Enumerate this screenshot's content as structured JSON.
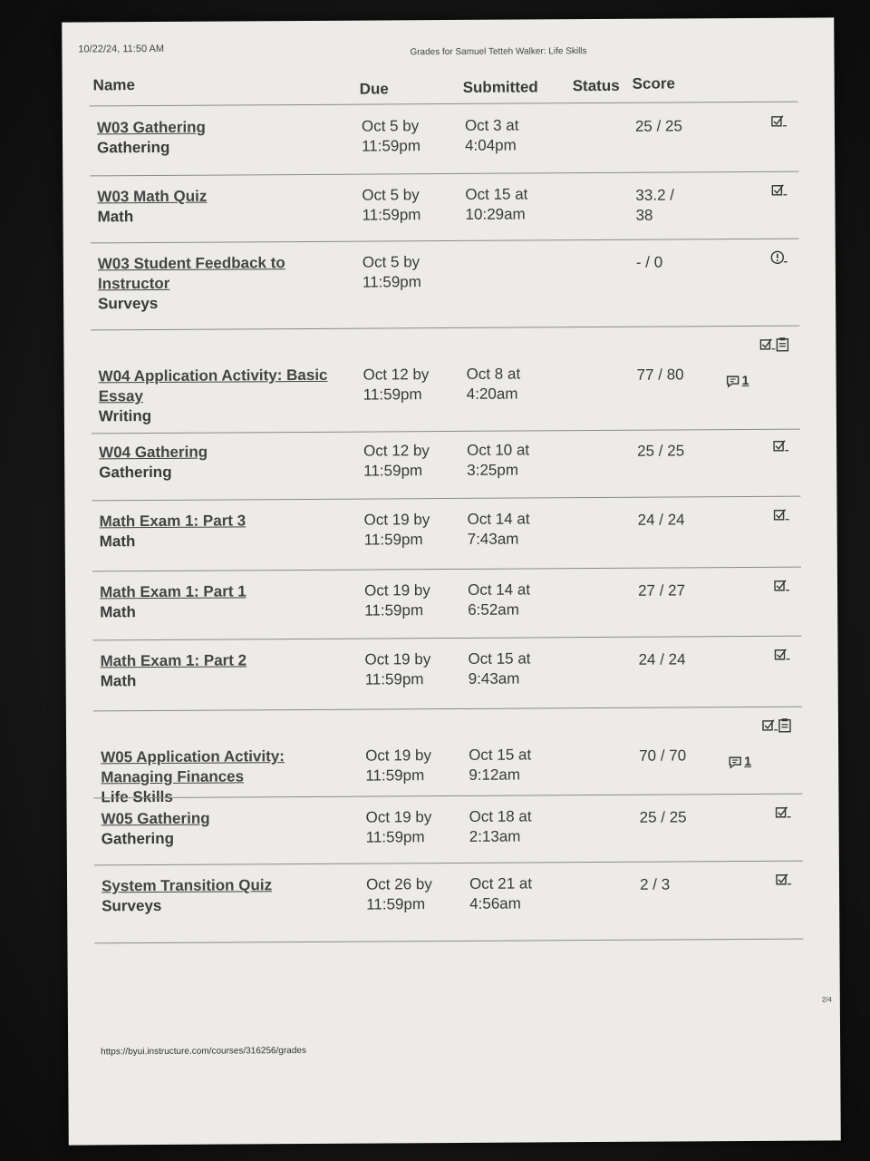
{
  "header": {
    "printed": "10/22/24, 11:50 AM",
    "title": "Grades for Samuel Tetteh Walker: Life Skills"
  },
  "columns": {
    "name": "Name",
    "due": "Due",
    "submitted": "Submitted",
    "status": "Status",
    "score": "Score"
  },
  "rows": [
    {
      "title": "W03 Gathering",
      "title_lines": [
        "W03 Gathering"
      ],
      "category": "Gathering",
      "due": [
        "Oct 5 by",
        "11:59pm"
      ],
      "submitted": [
        "Oct 3 at",
        "4:04pm"
      ],
      "score": [
        "25 / 25"
      ],
      "icons": [
        "rubric-check-icon"
      ]
    },
    {
      "title": "W03 Math Quiz",
      "title_lines": [
        "W03 Math Quiz"
      ],
      "category": "Math",
      "due": [
        "Oct 5 by",
        "11:59pm"
      ],
      "submitted": [
        "Oct 15 at",
        "10:29am"
      ],
      "score": [
        "33.2 /",
        "38"
      ],
      "icons": [
        "rubric-check-icon"
      ]
    },
    {
      "title": "W03 Student Feedback to Instructor",
      "title_lines": [
        "W03 Student Feedback to",
        "Instructor"
      ],
      "category": "Surveys",
      "due": [
        "Oct 5 by",
        "11:59pm"
      ],
      "submitted": [
        "",
        ""
      ],
      "score": [
        "- / 0"
      ],
      "icons": [
        "alert-circle-icon"
      ]
    },
    {
      "title": "W04 Application Activity: Basic Essay",
      "title_lines": [
        "W04 Application Activity: Basic",
        "Essay"
      ],
      "category": "Writing",
      "due": [
        "Oct 12 by",
        "11:59pm"
      ],
      "submitted": [
        "Oct 8 at",
        "4:20am"
      ],
      "score": [
        "77 / 80"
      ],
      "icons": [
        "rubric-check-icon",
        "clipboard-icon"
      ],
      "comments": "1"
    },
    {
      "title": "W04 Gathering",
      "title_lines": [
        "W04 Gathering"
      ],
      "category": "Gathering",
      "due": [
        "Oct 12 by",
        "11:59pm"
      ],
      "submitted": [
        "Oct 10 at",
        "3:25pm"
      ],
      "score": [
        "25 / 25"
      ],
      "icons": [
        "rubric-check-icon"
      ]
    },
    {
      "title": "Math Exam 1: Part 3",
      "title_lines": [
        "Math Exam 1: Part 3"
      ],
      "category": "Math",
      "due": [
        "Oct 19 by",
        "11:59pm"
      ],
      "submitted": [
        "Oct 14 at",
        "7:43am"
      ],
      "score": [
        "24 / 24"
      ],
      "icons": [
        "rubric-check-icon"
      ]
    },
    {
      "title": "Math Exam 1: Part 1",
      "title_lines": [
        "Math Exam 1: Part 1"
      ],
      "category": "Math",
      "due": [
        "Oct 19 by",
        "11:59pm"
      ],
      "submitted": [
        "Oct 14 at",
        "6:52am"
      ],
      "score": [
        "27 / 27"
      ],
      "icons": [
        "rubric-check-icon"
      ]
    },
    {
      "title": "Math Exam 1: Part 2",
      "title_lines": [
        "Math Exam 1: Part 2"
      ],
      "category": "Math",
      "due": [
        "Oct 19 by",
        "11:59pm"
      ],
      "submitted": [
        "Oct 15 at",
        "9:43am"
      ],
      "score": [
        "24 / 24"
      ],
      "icons": [
        "rubric-check-icon"
      ]
    },
    {
      "title": "W05 Application Activity: Managing Finances",
      "title_lines": [
        "W05 Application Activity:",
        "Managing Finances"
      ],
      "category": "Life Skills",
      "due": [
        "Oct 19 by",
        "11:59pm"
      ],
      "submitted": [
        "Oct 15 at",
        "9:12am"
      ],
      "score": [
        "70 / 70"
      ],
      "icons": [
        "rubric-check-icon",
        "clipboard-icon"
      ],
      "comments": "1"
    },
    {
      "title": "W05 Gathering",
      "title_lines": [
        "W05 Gathering"
      ],
      "category": "Gathering",
      "due": [
        "Oct 19 by",
        "11:59pm"
      ],
      "submitted": [
        "Oct 18 at",
        "2:13am"
      ],
      "score": [
        "25 / 25"
      ],
      "icons": [
        "rubric-check-icon"
      ]
    },
    {
      "title": "System Transition Quiz",
      "title_lines": [
        "System Transition Quiz"
      ],
      "category": "Surveys",
      "due": [
        "Oct 26 by",
        "11:59pm"
      ],
      "submitted": [
        "Oct 21 at",
        "4:56am"
      ],
      "score": [
        "2 / 3"
      ],
      "icons": [
        "rubric-check-icon"
      ]
    }
  ],
  "footer": {
    "url": "https://byui.instructure.com/courses/316256/grades",
    "page": "2/4"
  }
}
